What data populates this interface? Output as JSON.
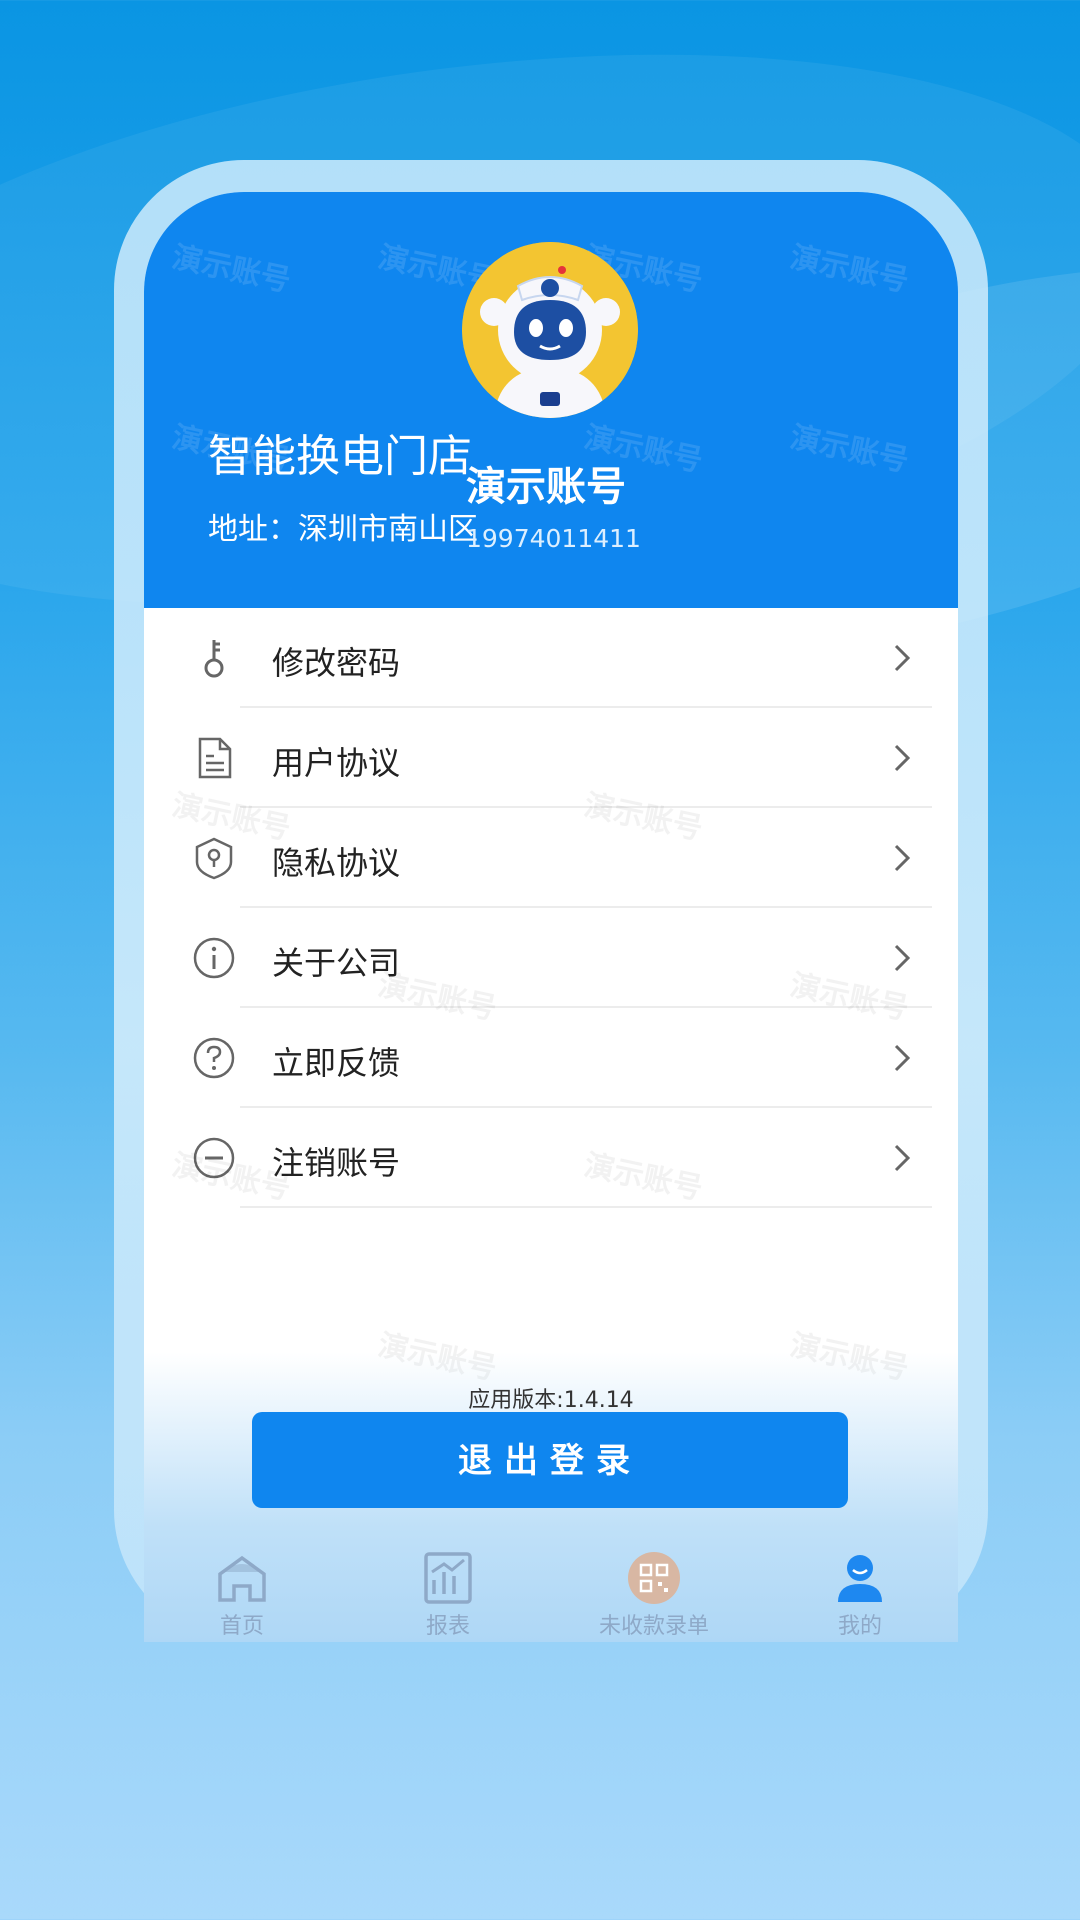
{
  "store": {
    "name": "智能换电门店",
    "address": "地址：深圳市南山区"
  },
  "account": {
    "name": "演示账号",
    "phone": "19974011411",
    "avatar_icon": "robot-avatar-icon"
  },
  "watermark_text": "演示账号",
  "menu": [
    {
      "label": "修改密码",
      "icon": "key-icon"
    },
    {
      "label": "用户协议",
      "icon": "document-icon"
    },
    {
      "label": "隐私协议",
      "icon": "shield-icon"
    },
    {
      "label": "关于公司",
      "icon": "info-icon"
    },
    {
      "label": "立即反馈",
      "icon": "question-icon"
    },
    {
      "label": "注销账号",
      "icon": "minus-circle-icon"
    }
  ],
  "version": "应用版本:1.4.14",
  "logout_label": "退出登录",
  "tabs": [
    {
      "label": "首页",
      "icon": "home-icon"
    },
    {
      "label": "报表",
      "icon": "chart-icon"
    },
    {
      "label": "未收款录单",
      "icon": "qr-icon"
    },
    {
      "label": "我的",
      "icon": "user-icon"
    }
  ],
  "colors": {
    "accent": "#0f86ef",
    "background_top": "#0a95e3",
    "avatar_bg": "#f3c531",
    "tab_inactive": "#8ea9c8"
  }
}
